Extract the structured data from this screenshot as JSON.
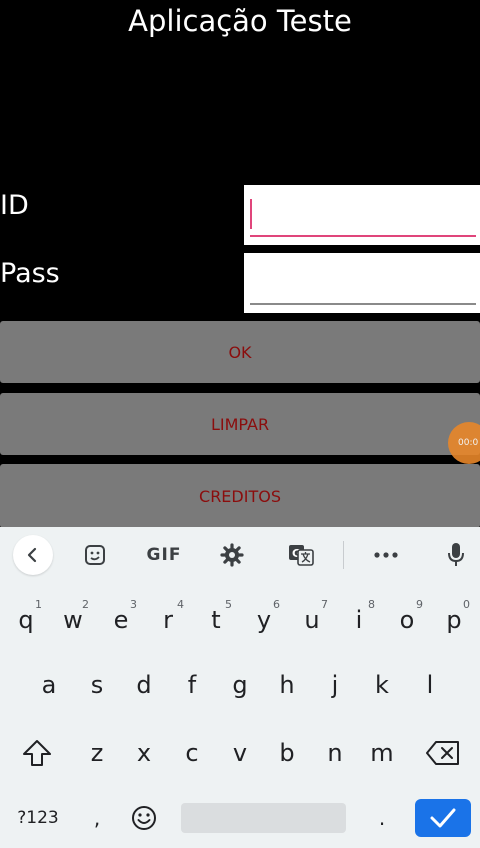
{
  "app": {
    "title": "Aplicação Teste",
    "id_label": "ID",
    "pass_label": "Pass",
    "id_value": "",
    "pass_value": "",
    "buttons": {
      "ok": "OK",
      "clear": "LIMPAR",
      "credits": "CREDITOS"
    },
    "recording_timer": "00:0",
    "accent_color": "#e0457b",
    "button_text_color": "#8b0d0d"
  },
  "keyboard": {
    "toolbar": {
      "gif_label": "GIF",
      "icons": [
        "chevron-left-icon",
        "sticker-icon",
        "gif-icon",
        "gear-icon",
        "translate-icon",
        "more-icon",
        "mic-icon"
      ]
    },
    "row1": [
      {
        "key": "q",
        "hint": "1"
      },
      {
        "key": "w",
        "hint": "2"
      },
      {
        "key": "e",
        "hint": "3"
      },
      {
        "key": "r",
        "hint": "4"
      },
      {
        "key": "t",
        "hint": "5"
      },
      {
        "key": "y",
        "hint": "6"
      },
      {
        "key": "u",
        "hint": "7"
      },
      {
        "key": "i",
        "hint": "8"
      },
      {
        "key": "o",
        "hint": "9"
      },
      {
        "key": "p",
        "hint": "0"
      }
    ],
    "row2": [
      "a",
      "s",
      "d",
      "f",
      "g",
      "h",
      "j",
      "k",
      "l"
    ],
    "row3": [
      "z",
      "x",
      "c",
      "v",
      "b",
      "n",
      "m"
    ],
    "row4": {
      "symbols": "?123",
      "comma": ",",
      "period": "."
    },
    "enter_color": "#1a73e8"
  }
}
